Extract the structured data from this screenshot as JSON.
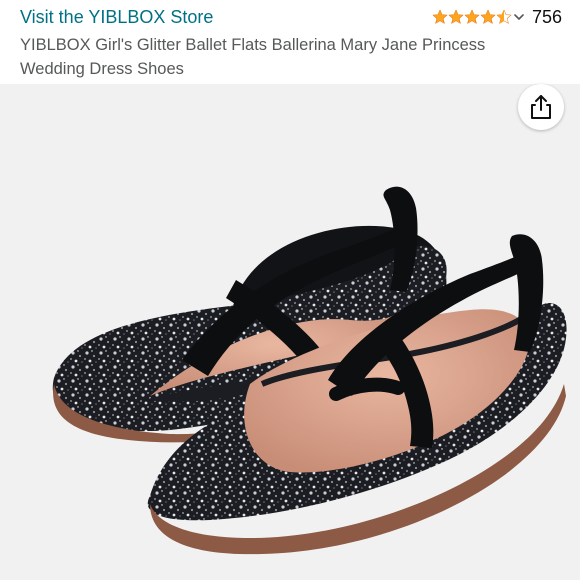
{
  "header": {
    "store_link": "Visit the YIBLBOX Store",
    "rating_value": 4.5,
    "review_count": "756",
    "product_title": "YIBLBOX Girl's Glitter Ballet Flats Ballerina Mary Jane Princess Wedding Dress Shoes"
  },
  "product_image": {
    "subject": "pair of black glitter ballet flats with crossed elastic straps"
  },
  "share": {
    "icon": "share-icon"
  },
  "colors": {
    "link": "#007185",
    "star": "#ffa41c",
    "title_text": "#565959",
    "image_background": "#f2f1f1"
  }
}
